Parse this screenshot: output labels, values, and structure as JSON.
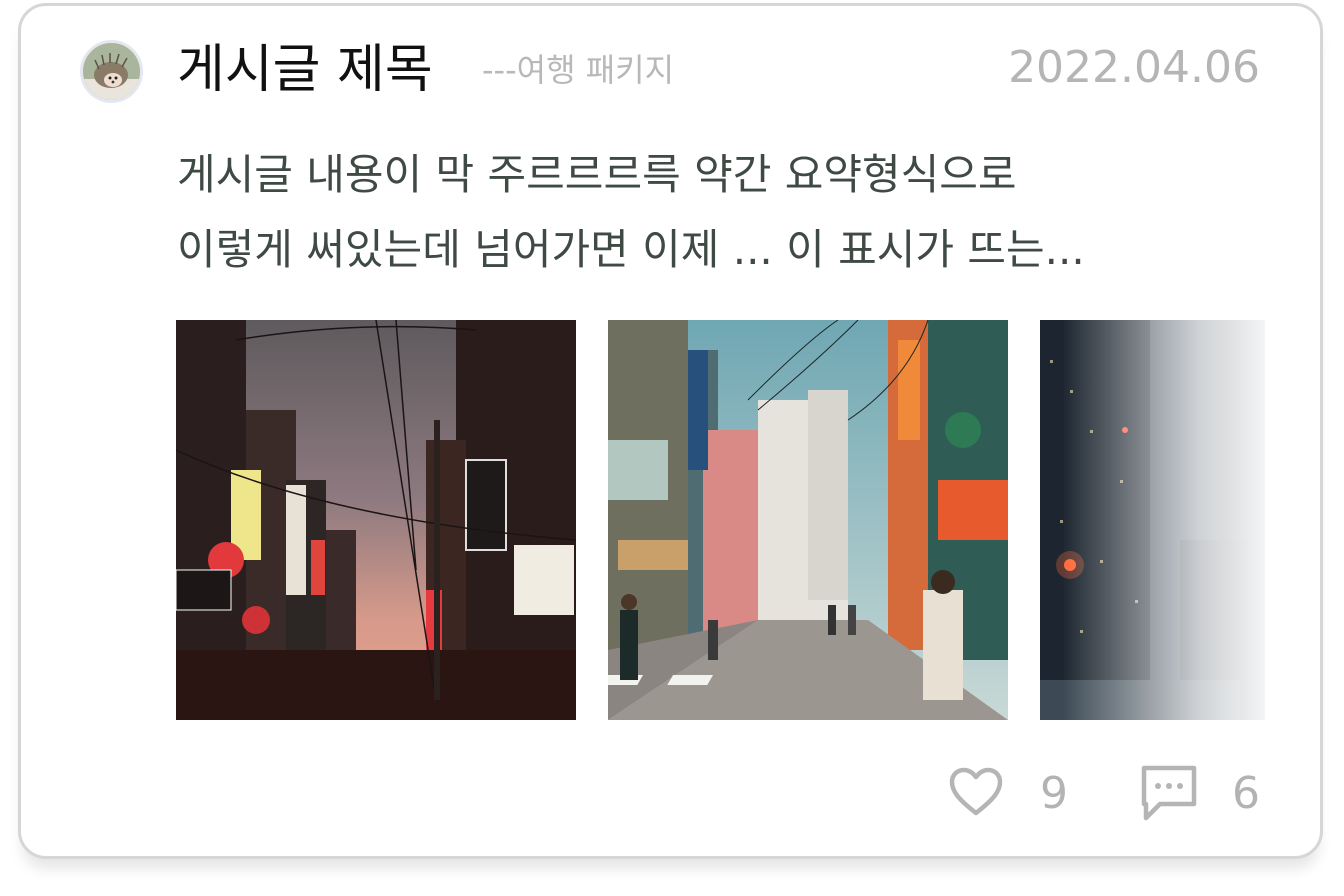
{
  "post": {
    "title": "게시글 제목",
    "subtitle": "---여행 패키지",
    "date": "2022.04.06",
    "summary_line_1": "게시글 내용이 막 주르르르륵 약간 요약형식으로",
    "summary_line_2": "이렇게 써있는데 넘어가면 이제 ... 이 표시가 뜨는...",
    "avatar_icon": "hedgehog-avatar",
    "photos": [
      {
        "name": "night-street-photo"
      },
      {
        "name": "shopping-street-photo"
      },
      {
        "name": "city-towers-photo"
      }
    ]
  },
  "stats": {
    "likes": "9",
    "comments": "6",
    "like_icon": "heart-icon",
    "comment_icon": "comment-icon"
  },
  "colors": {
    "border": "#d6d6d6",
    "muted": "#b3b3b3",
    "body_text": "#3f4a44"
  }
}
